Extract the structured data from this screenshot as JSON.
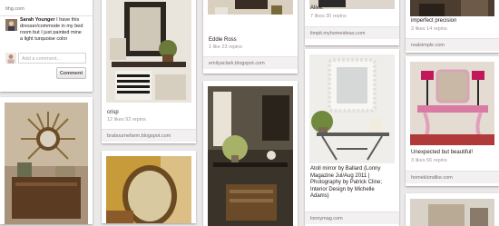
{
  "colors": {
    "background": "#ebe8e8",
    "caption": "#221919",
    "meta": "#a09595",
    "source_bar": "#f2f0f0"
  },
  "column1": {
    "top_source": "tihg.com",
    "comment": {
      "author": "Sarah Younger",
      "text": "I have this dresser/commode in my bed room but I just painted mine a light turquoise color"
    },
    "add_comment_placeholder": "Add a comment...",
    "comment_button": "Comment"
  },
  "pins": {
    "crisp": {
      "caption": "crisp",
      "stats": "12 likes   92 repins",
      "source": "brabournefarm.blogspot.com"
    },
    "eddie": {
      "caption": "Eddie Ross",
      "stats": "1 like   23 repins",
      "source": "emilyaclark.blogspot.com"
    },
    "alive": {
      "caption": "Alive.",
      "stats": "7 likes   30 repins",
      "source": "limpit.myhomeideas.com"
    },
    "atoll": {
      "caption": "Atoll mirror by Ballard (Lonny Magazine Jul/Aug 2011 | Photography by Patrick Cline; Interior Design by Michelle Adams)",
      "source": "lonnymag.com"
    },
    "imperfect": {
      "caption": "imperfect precision",
      "stats": "3 likes   14 repins",
      "source": "realsimple.com"
    },
    "unexpected": {
      "caption": "Unexpected but beautiful!",
      "stats": "3 likes   56 repins",
      "source": "homeklondike.com"
    }
  }
}
